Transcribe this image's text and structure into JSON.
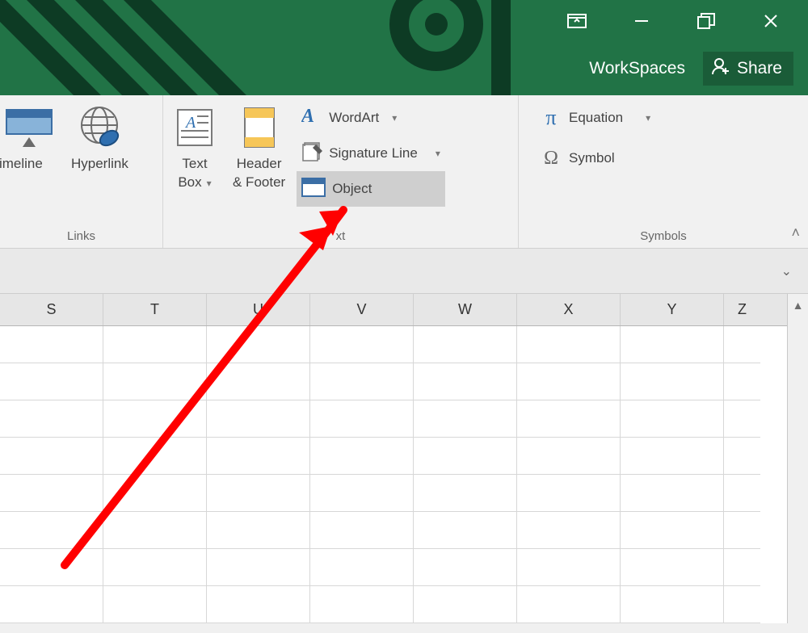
{
  "titlebar": {
    "workspaces": "WorkSpaces",
    "share": "Share"
  },
  "ribbon": {
    "links": {
      "label": "Links",
      "timeline": "Timeline",
      "hyperlink": "Hyperlink"
    },
    "text": {
      "label": "Text",
      "textbox_line1": "Text",
      "textbox_line2": "Box",
      "header_footer_line1": "Header",
      "header_footer_line2": "& Footer",
      "wordart": "WordArt",
      "signature": "Signature Line",
      "object": "Object"
    },
    "symbols": {
      "label": "Symbols",
      "equation": "Equation",
      "symbol": "Symbol"
    }
  },
  "columns": [
    "S",
    "T",
    "U",
    "V",
    "W",
    "X",
    "Y",
    "Z"
  ]
}
